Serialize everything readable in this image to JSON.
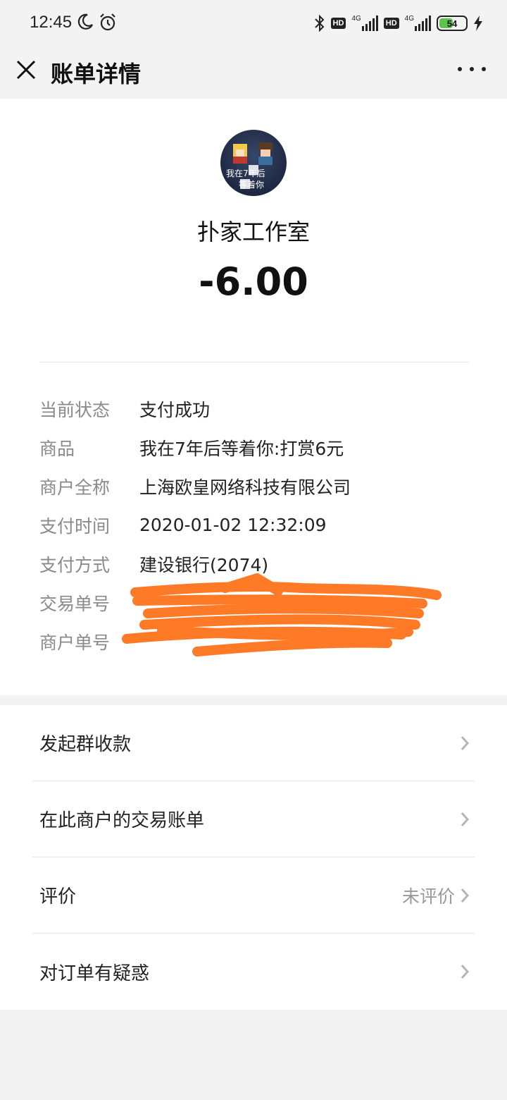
{
  "status_bar": {
    "time": "12:45",
    "hd1": "HD",
    "net1": "4G",
    "hd2": "HD",
    "net2": "4G",
    "battery": "54",
    "battery_level": 0.54,
    "battery_color": "#5ec24f",
    "icons": [
      "moon-icon",
      "alarm-icon",
      "bluetooth-icon",
      "signal-icon",
      "charging-icon"
    ]
  },
  "header": {
    "title": "账单详情",
    "close_icon": "close-icon",
    "more_icon": "more-icon"
  },
  "bill": {
    "avatar_text": [
      "我在7年后",
      "等着你"
    ],
    "merchant_name": "扑家工作室",
    "amount": "-6.00",
    "details": [
      {
        "label": "当前状态",
        "value": "支付成功"
      },
      {
        "label": "商品",
        "value": "我在7年后等着你:打赏6元"
      },
      {
        "label": "商户全称",
        "value": "上海欧皇网络科技有限公司"
      },
      {
        "label": "支付时间",
        "value": "2020-01-02 12:32:09"
      },
      {
        "label": "支付方式",
        "value": "建设银行(2074)"
      },
      {
        "label": "交易单号",
        "value": ""
      },
      {
        "label": "商户单号",
        "value": ""
      }
    ],
    "redaction_color": "#ff7a26"
  },
  "actions": [
    {
      "label": "发起群收款",
      "hint": ""
    },
    {
      "label": "在此商户的交易账单",
      "hint": ""
    },
    {
      "label": "评价",
      "hint": "未评价"
    },
    {
      "label": "对订单有疑惑",
      "hint": ""
    }
  ]
}
